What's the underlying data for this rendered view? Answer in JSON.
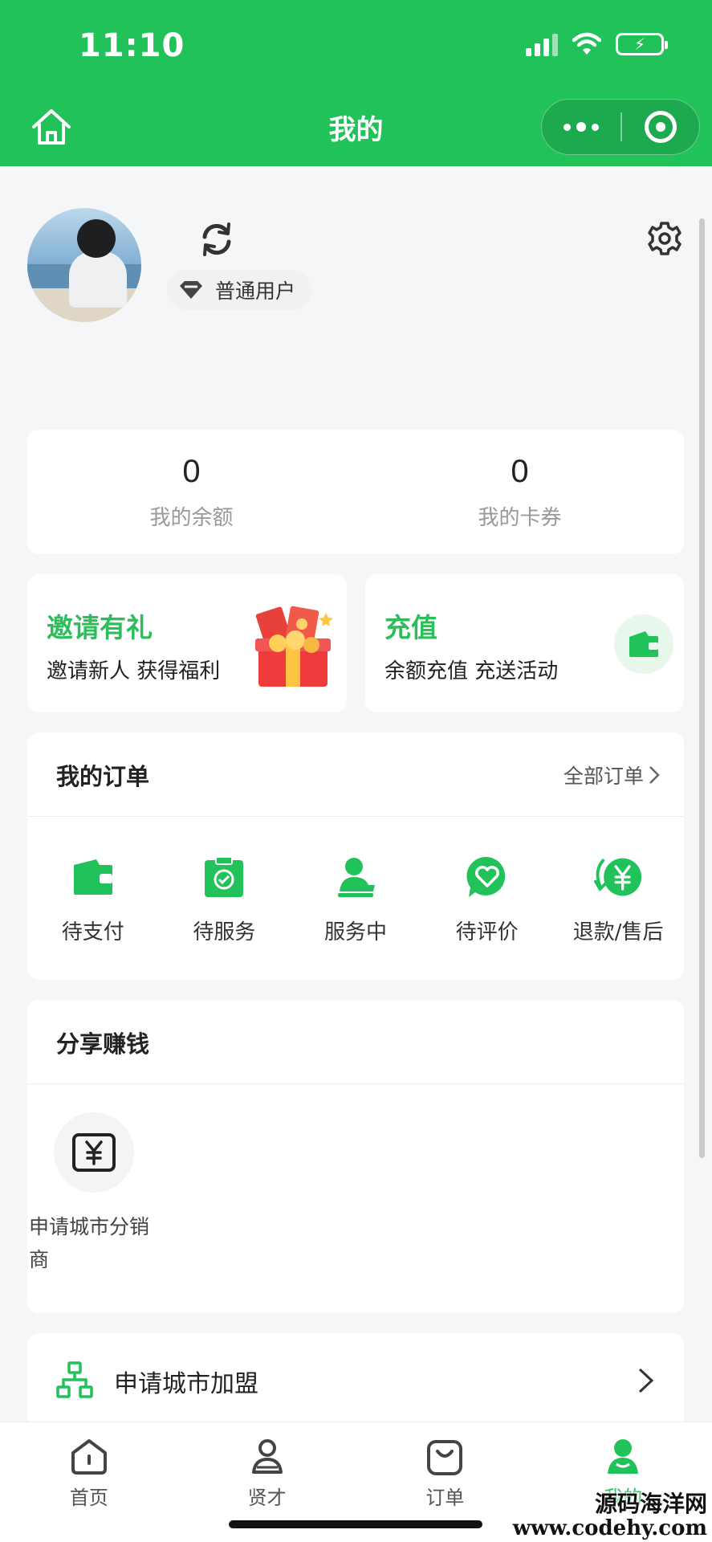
{
  "status_bar": {
    "time": "11:10"
  },
  "nav": {
    "title": "我的"
  },
  "profile": {
    "level": "普通用户"
  },
  "stats": [
    {
      "value": "0",
      "label": "我的余额"
    },
    {
      "value": "0",
      "label": "我的卡券"
    }
  ],
  "promos": {
    "invite": {
      "title": "邀请有礼",
      "desc": "邀请新人 获得福利"
    },
    "recharge": {
      "title": "充值",
      "desc": "余额充值 充送活动"
    }
  },
  "orders": {
    "title": "我的订单",
    "all_label": "全部订单",
    "items": [
      {
        "label": "待支付",
        "icon": "wallet-icon"
      },
      {
        "label": "待服务",
        "icon": "clipboard-check-icon"
      },
      {
        "label": "服务中",
        "icon": "service-person-icon"
      },
      {
        "label": "待评价",
        "icon": "heart-chat-icon"
      },
      {
        "label": "退款/售后",
        "icon": "refund-yen-icon"
      }
    ]
  },
  "share": {
    "title": "分享赚钱",
    "item_label": "申请城市分销商"
  },
  "join": {
    "label": "申请城市加盟"
  },
  "tabbar": [
    {
      "label": "首页",
      "icon": "home-tab-icon"
    },
    {
      "label": "贤才",
      "icon": "talent-tab-icon"
    },
    {
      "label": "订单",
      "icon": "bag-tab-icon"
    },
    {
      "label": "我的",
      "icon": "profile-tab-icon",
      "active": true
    }
  ],
  "watermark": {
    "cn": "源码海洋网",
    "en": "www.codehy.com"
  },
  "colors": {
    "primary": "#22c25a",
    "background": "#f5f6f8"
  }
}
